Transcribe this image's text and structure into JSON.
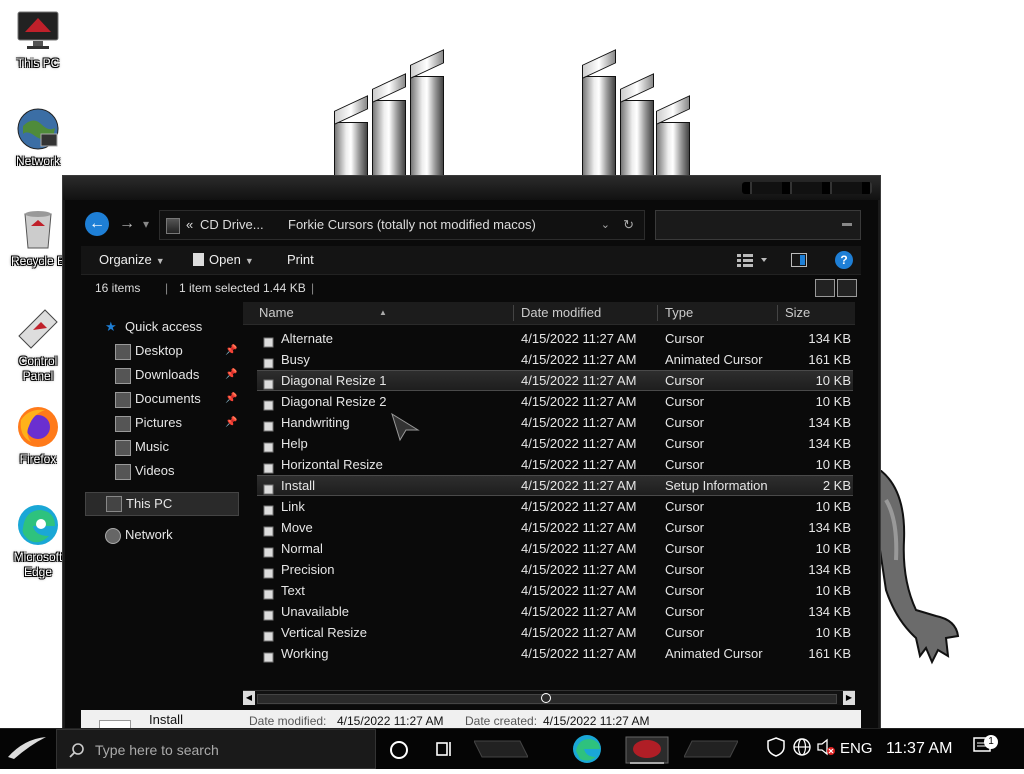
{
  "desktop": {
    "icons": [
      {
        "label": "This PC"
      },
      {
        "label": "Network"
      },
      {
        "label": "Recycle B"
      },
      {
        "label": "Control Panel"
      },
      {
        "label": "Firefox"
      },
      {
        "label": "Microsoft Edge"
      }
    ]
  },
  "window": {
    "breadcrumb": {
      "chevron": "«",
      "segment1": "CD Drive...",
      "segment2": "Forkie Cursors (totally not modified macos)"
    },
    "toolbar": {
      "organize": "Organize",
      "open": "Open",
      "print": "Print",
      "help": "?"
    },
    "status": {
      "items": "16 items",
      "selected": "1 item selected",
      "size": "1.44 KB"
    },
    "nav": {
      "quick_access": "Quick access",
      "desktop": "Desktop",
      "downloads": "Downloads",
      "documents": "Documents",
      "pictures": "Pictures",
      "music": "Music",
      "videos": "Videos",
      "this_pc": "This PC",
      "network": "Network"
    },
    "columns": {
      "name": "Name",
      "date": "Date modified",
      "type": "Type",
      "size": "Size"
    },
    "files": [
      {
        "name": "Alternate",
        "date": "4/15/2022 11:27 AM",
        "type": "Cursor",
        "size": "134 KB"
      },
      {
        "name": "Busy",
        "date": "4/15/2022 11:27 AM",
        "type": "Animated Cursor",
        "size": "161 KB"
      },
      {
        "name": "Diagonal Resize 1",
        "date": "4/15/2022 11:27 AM",
        "type": "Cursor",
        "size": "10 KB"
      },
      {
        "name": "Diagonal Resize 2",
        "date": "4/15/2022 11:27 AM",
        "type": "Cursor",
        "size": "10 KB"
      },
      {
        "name": "Handwriting",
        "date": "4/15/2022 11:27 AM",
        "type": "Cursor",
        "size": "134 KB"
      },
      {
        "name": "Help",
        "date": "4/15/2022 11:27 AM",
        "type": "Cursor",
        "size": "134 KB"
      },
      {
        "name": "Horizontal Resize",
        "date": "4/15/2022 11:27 AM",
        "type": "Cursor",
        "size": "10 KB"
      },
      {
        "name": "Install",
        "date": "4/15/2022 11:27 AM",
        "type": "Setup Information",
        "size": "2 KB"
      },
      {
        "name": "Link",
        "date": "4/15/2022 11:27 AM",
        "type": "Cursor",
        "size": "10 KB"
      },
      {
        "name": "Move",
        "date": "4/15/2022 11:27 AM",
        "type": "Cursor",
        "size": "134 KB"
      },
      {
        "name": "Normal",
        "date": "4/15/2022 11:27 AM",
        "type": "Cursor",
        "size": "10 KB"
      },
      {
        "name": "Precision",
        "date": "4/15/2022 11:27 AM",
        "type": "Cursor",
        "size": "134 KB"
      },
      {
        "name": "Text",
        "date": "4/15/2022 11:27 AM",
        "type": "Cursor",
        "size": "10 KB"
      },
      {
        "name": "Unavailable",
        "date": "4/15/2022 11:27 AM",
        "type": "Cursor",
        "size": "134 KB"
      },
      {
        "name": "Vertical Resize",
        "date": "4/15/2022 11:27 AM",
        "type": "Cursor",
        "size": "10 KB"
      },
      {
        "name": "Working",
        "date": "4/15/2022 11:27 AM",
        "type": "Animated Cursor",
        "size": "161 KB"
      }
    ],
    "details": {
      "name": "Install",
      "modified_label": "Date modified:",
      "modified_value": "4/15/2022 11:27 AM",
      "created_label": "Date created:",
      "created_value": "4/15/2022 11:27 AM"
    }
  },
  "taskbar": {
    "search_placeholder": "Type here to search",
    "language": "ENG",
    "time": "11:37 AM",
    "notification_count": "1"
  },
  "colors": {
    "accent": "#1e7fd6",
    "window_bg": "#0a0a0a",
    "taskbar_bg": "#050505"
  }
}
